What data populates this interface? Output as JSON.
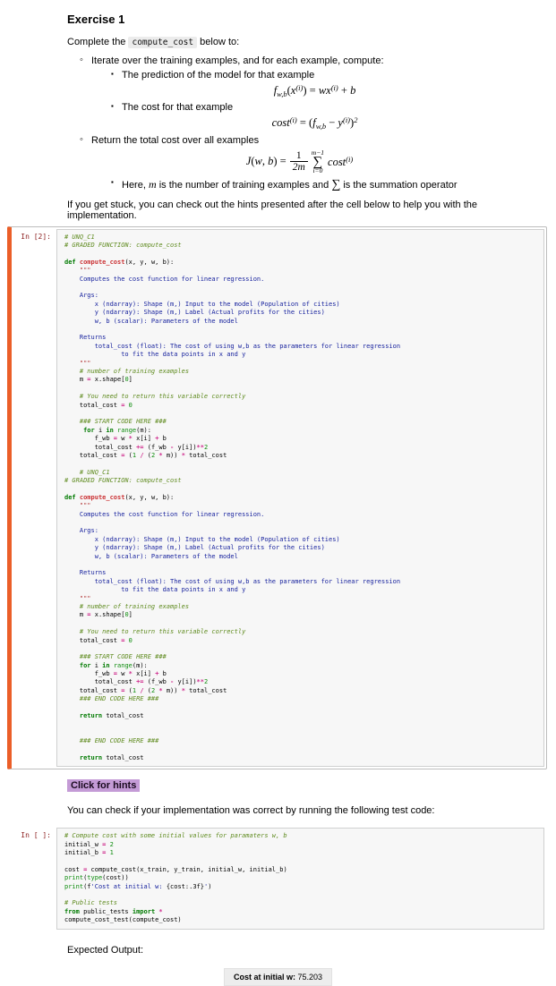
{
  "markdown1": {
    "heading": "Exercise 1",
    "intro_tokens": [
      [
        "md",
        "Complete the "
      ],
      [
        "code",
        "compute_cost"
      ],
      [
        "md",
        " below to:"
      ]
    ],
    "bullet1": "Iterate over the training examples, and for each example, compute:",
    "sub1": "The prediction of the model for that example",
    "formula1": [
      [
        "fi",
        "f"
      ],
      [
        "fsub",
        "w,b"
      ],
      [
        "fn",
        "("
      ],
      [
        "fi",
        "x"
      ],
      [
        "fsup",
        "(i)"
      ],
      [
        "fn",
        ") = "
      ],
      [
        "fi",
        "wx"
      ],
      [
        "fsup",
        "(i)"
      ],
      [
        "fn",
        " + "
      ],
      [
        "fi",
        "b"
      ]
    ],
    "sub2": "The cost for that example",
    "formula2": [
      [
        "fi",
        "cost"
      ],
      [
        "fsup",
        "(i)"
      ],
      [
        "fn",
        " = ("
      ],
      [
        "fi",
        "f"
      ],
      [
        "fsub",
        "w,b"
      ],
      [
        "fn",
        " − "
      ],
      [
        "fi",
        "y"
      ],
      [
        "fsup",
        "(i)"
      ],
      [
        "fn",
        ")"
      ],
      [
        "fsup",
        "2"
      ]
    ],
    "bullet2": "Return the total cost over all examples",
    "formula3_lhs": [
      [
        "fi",
        "J"
      ],
      [
        "fn",
        "("
      ],
      [
        "fi",
        "w"
      ],
      [
        "fn",
        ", "
      ],
      [
        "fi",
        "b"
      ],
      [
        "fn",
        ") = "
      ]
    ],
    "frac_num": "1",
    "frac_den": "2m",
    "sum_top": "m−1",
    "sum_sym": "∑",
    "sum_bottom": "i=0",
    "formula3_rhs": [
      [
        "fi",
        "cost"
      ],
      [
        "fsup",
        "(i)"
      ]
    ],
    "sub3_tokens": [
      [
        "fn2",
        "Here, "
      ],
      [
        "fim",
        "m"
      ],
      [
        "fn2",
        " is the number of training examples and "
      ],
      [
        "fsig",
        "∑"
      ],
      [
        "fn2",
        " is the summation operator"
      ]
    ],
    "stuck": "If you get stuck, you can check out the hints presented after the cell below to help you with the implementation."
  },
  "cell1": {
    "prompt": "In [2]:",
    "lines": [
      [
        [
          "c",
          "# UNQ_C1"
        ]
      ],
      [
        [
          "c",
          "# GRADED FUNCTION: compute_cost"
        ]
      ],
      [],
      [
        [
          "k",
          "def"
        ],
        [
          "n",
          " "
        ],
        [
          "d",
          "compute_cost"
        ],
        [
          "n",
          "(x, y, w, b): "
        ]
      ],
      [
        [
          "n",
          "    "
        ],
        [
          "q",
          "\"\"\""
        ]
      ],
      [
        [
          "s",
          "    Computes the cost function for linear regression."
        ]
      ],
      [],
      [
        [
          "s",
          "    Args:"
        ]
      ],
      [
        [
          "s",
          "        x (ndarray): Shape (m,) Input to the model (Population of cities) "
        ]
      ],
      [
        [
          "s",
          "        y (ndarray): Shape (m,) Label (Actual profits for the cities) "
        ]
      ],
      [
        [
          "s",
          "        w, b (scalar): Parameters of the model"
        ]
      ],
      [],
      [
        [
          "s",
          "    Returns"
        ]
      ],
      [
        [
          "s",
          "        total_cost (float): The cost of using w,b as the parameters for linear regression"
        ]
      ],
      [
        [
          "s",
          "               to fit the data points in x and y"
        ]
      ],
      [
        [
          "n",
          "    "
        ],
        [
          "q",
          "\"\"\""
        ]
      ],
      [
        [
          "n",
          "    "
        ],
        [
          "c",
          "# number of training examples"
        ]
      ],
      [
        [
          "n",
          "    m "
        ],
        [
          "o",
          "="
        ],
        [
          "n",
          " x.shape["
        ],
        [
          "m",
          "0"
        ],
        [
          "n",
          "] "
        ]
      ],
      [],
      [
        [
          "n",
          "    "
        ],
        [
          "c",
          "# You need to return this variable correctly"
        ]
      ],
      [
        [
          "n",
          "    total_cost "
        ],
        [
          "o",
          "="
        ],
        [
          "n",
          " "
        ],
        [
          "m",
          "0"
        ]
      ],
      [],
      [
        [
          "n",
          "    "
        ],
        [
          "c",
          "### START CODE HERE ###  "
        ]
      ],
      [
        [
          "n",
          "     "
        ],
        [
          "k",
          "for"
        ],
        [
          "n",
          " i "
        ],
        [
          "k",
          "in"
        ],
        [
          "n",
          " "
        ],
        [
          "b",
          "range"
        ],
        [
          "n",
          "(m):"
        ]
      ],
      [
        [
          "n",
          "        f_wb "
        ],
        [
          "o",
          "="
        ],
        [
          "n",
          " w "
        ],
        [
          "o",
          "*"
        ],
        [
          "n",
          " x[i] "
        ],
        [
          "o",
          "+"
        ],
        [
          "n",
          " b"
        ]
      ],
      [
        [
          "n",
          "        total_cost "
        ],
        [
          "o",
          "+="
        ],
        [
          "n",
          " (f_wb "
        ],
        [
          "o",
          "-"
        ],
        [
          "n",
          " y[i])"
        ],
        [
          "o",
          "**"
        ],
        [
          "m",
          "2"
        ]
      ],
      [
        [
          "n",
          "    total_cost "
        ],
        [
          "o",
          "="
        ],
        [
          "n",
          " ("
        ],
        [
          "m",
          "1"
        ],
        [
          "n",
          " "
        ],
        [
          "o",
          "/"
        ],
        [
          "n",
          " ("
        ],
        [
          "m",
          "2"
        ],
        [
          "n",
          " "
        ],
        [
          "o",
          "*"
        ],
        [
          "n",
          " m)) "
        ],
        [
          "o",
          "*"
        ],
        [
          "n",
          " total_cost"
        ]
      ],
      [],
      [
        [
          "n",
          "    "
        ],
        [
          "c",
          "# UNQ_C1"
        ]
      ],
      [
        [
          "c",
          "# GRADED FUNCTION: compute_cost"
        ]
      ],
      [],
      [
        [
          "k",
          "def"
        ],
        [
          "n",
          " "
        ],
        [
          "d",
          "compute_cost"
        ],
        [
          "n",
          "(x, y, w, b): "
        ]
      ],
      [
        [
          "n",
          "    "
        ],
        [
          "q",
          "\"\"\""
        ]
      ],
      [
        [
          "s",
          "    Computes the cost function for linear regression."
        ]
      ],
      [],
      [
        [
          "s",
          "    Args:"
        ]
      ],
      [
        [
          "s",
          "        x (ndarray): Shape (m,) Input to the model (Population of cities) "
        ]
      ],
      [
        [
          "s",
          "        y (ndarray): Shape (m,) Label (Actual profits for the cities) "
        ]
      ],
      [
        [
          "s",
          "        w, b (scalar): Parameters of the model"
        ]
      ],
      [],
      [
        [
          "s",
          "    Returns"
        ]
      ],
      [
        [
          "s",
          "        total_cost (float): The cost of using w,b as the parameters for linear regression"
        ]
      ],
      [
        [
          "s",
          "               to fit the data points in x and y"
        ]
      ],
      [
        [
          "n",
          "    "
        ],
        [
          "q",
          "\"\"\""
        ]
      ],
      [
        [
          "n",
          "    "
        ],
        [
          "c",
          "# number of training examples"
        ]
      ],
      [
        [
          "n",
          "    m "
        ],
        [
          "o",
          "="
        ],
        [
          "n",
          " x.shape["
        ],
        [
          "m",
          "0"
        ],
        [
          "n",
          "] "
        ]
      ],
      [],
      [
        [
          "n",
          "    "
        ],
        [
          "c",
          "# You need to return this variable correctly"
        ]
      ],
      [
        [
          "n",
          "    total_cost "
        ],
        [
          "o",
          "="
        ],
        [
          "n",
          " "
        ],
        [
          "m",
          "0"
        ]
      ],
      [],
      [
        [
          "n",
          "    "
        ],
        [
          "c",
          "### START CODE HERE ###  "
        ]
      ],
      [
        [
          "n",
          "    "
        ],
        [
          "k",
          "for"
        ],
        [
          "n",
          " i "
        ],
        [
          "k",
          "in"
        ],
        [
          "n",
          " "
        ],
        [
          "b",
          "range"
        ],
        [
          "n",
          "(m):"
        ]
      ],
      [
        [
          "n",
          "        f_wb "
        ],
        [
          "o",
          "="
        ],
        [
          "n",
          " w "
        ],
        [
          "o",
          "*"
        ],
        [
          "n",
          " x[i] "
        ],
        [
          "o",
          "+"
        ],
        [
          "n",
          " b"
        ]
      ],
      [
        [
          "n",
          "        total_cost "
        ],
        [
          "o",
          "+="
        ],
        [
          "n",
          " (f_wb "
        ],
        [
          "o",
          "-"
        ],
        [
          "n",
          " y[i])"
        ],
        [
          "o",
          "**"
        ],
        [
          "m",
          "2"
        ]
      ],
      [
        [
          "n",
          "    total_cost "
        ],
        [
          "o",
          "="
        ],
        [
          "n",
          " ("
        ],
        [
          "m",
          "1"
        ],
        [
          "n",
          " "
        ],
        [
          "o",
          "/"
        ],
        [
          "n",
          " ("
        ],
        [
          "m",
          "2"
        ],
        [
          "n",
          " "
        ],
        [
          "o",
          "*"
        ],
        [
          "n",
          " m)) "
        ],
        [
          "o",
          "*"
        ],
        [
          "n",
          " total_cost"
        ]
      ],
      [
        [
          "n",
          "    "
        ],
        [
          "c",
          "### END CODE HERE ### "
        ]
      ],
      [],
      [
        [
          "n",
          "    "
        ],
        [
          "k",
          "return"
        ],
        [
          "n",
          " total_cost"
        ]
      ],
      [],
      [],
      [
        [
          "n",
          "    "
        ],
        [
          "c",
          "### END CODE HERE ### "
        ]
      ],
      [],
      [
        [
          "n",
          "    "
        ],
        [
          "k",
          "return"
        ],
        [
          "n",
          " total_cost"
        ]
      ]
    ]
  },
  "hints": {
    "label": "Click for hints"
  },
  "markdown2": {
    "text": "You can check if your implementation was correct by running the following test code:"
  },
  "cell2": {
    "prompt": "In [ ]:",
    "lines": [
      [
        [
          "c",
          "# Compute cost with some initial values for paramaters w, b"
        ]
      ],
      [
        [
          "n",
          "initial_w "
        ],
        [
          "o",
          "="
        ],
        [
          "n",
          " "
        ],
        [
          "m",
          "2"
        ]
      ],
      [
        [
          "n",
          "initial_b "
        ],
        [
          "o",
          "="
        ],
        [
          "n",
          " "
        ],
        [
          "m",
          "1"
        ]
      ],
      [],
      [
        [
          "n",
          "cost "
        ],
        [
          "o",
          "="
        ],
        [
          "n",
          " compute_cost(x_train, y_train, initial_w, initial_b)"
        ]
      ],
      [
        [
          "b",
          "print"
        ],
        [
          "n",
          "("
        ],
        [
          "b",
          "type"
        ],
        [
          "n",
          "(cost))"
        ]
      ],
      [
        [
          "b",
          "print"
        ],
        [
          "n",
          "(f"
        ],
        [
          "s",
          "'Cost at initial w: "
        ],
        [
          "n",
          "{cost:.3f}"
        ],
        [
          "s",
          "'"
        ],
        [
          "n",
          ")"
        ]
      ],
      [],
      [
        [
          "c",
          "# Public tests"
        ]
      ],
      [
        [
          "k",
          "from"
        ],
        [
          "n",
          " public_tests "
        ],
        [
          "k",
          "import"
        ],
        [
          "n",
          " "
        ],
        [
          "o",
          "*"
        ]
      ],
      [
        [
          "n",
          "compute_cost_test(compute_cost)"
        ]
      ]
    ]
  },
  "expected": {
    "label": "Expected Output:",
    "header": "Cost at initial w:",
    "value": "75.203"
  },
  "colors": {
    "selected_cell_accent": "#eb5e28",
    "cell_background": "#f7f7f7",
    "hints_highlight": "#c49bd6",
    "prompt_color": "#8b1d1d"
  }
}
